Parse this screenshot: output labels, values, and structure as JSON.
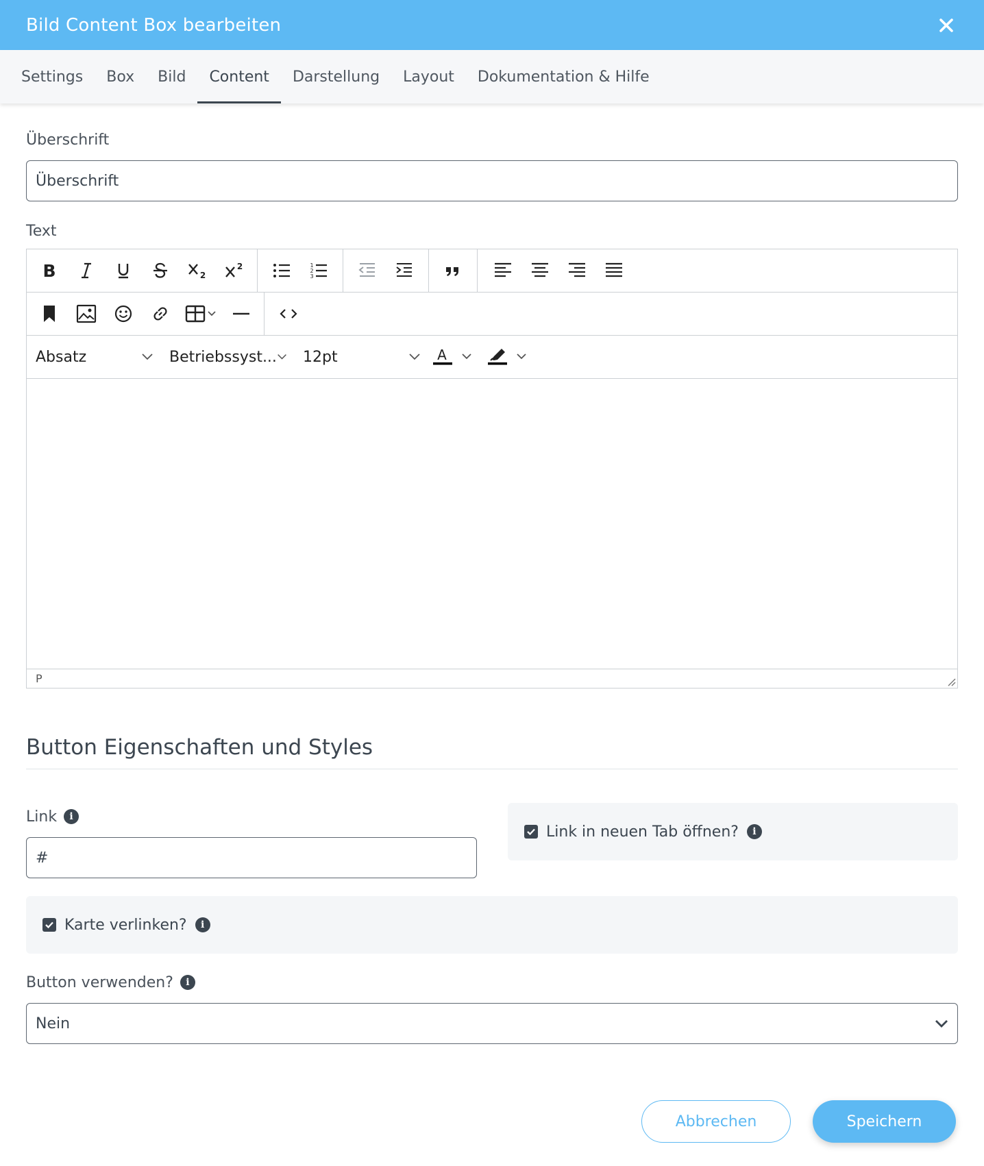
{
  "dialog": {
    "title": "Bild Content Box bearbeiten",
    "close_icon": "close-icon"
  },
  "tabs": [
    {
      "label": "Settings"
    },
    {
      "label": "Box"
    },
    {
      "label": "Bild"
    },
    {
      "label": "Content",
      "active": true
    },
    {
      "label": "Darstellung"
    },
    {
      "label": "Layout"
    },
    {
      "label": "Dokumentation & Hilfe"
    }
  ],
  "heading_field": {
    "label": "Überschrift",
    "value": "Überschrift"
  },
  "text_field": {
    "label": "Text",
    "toolbar": {
      "block_format": "Absatz",
      "font_family": "Betriebssyst...",
      "font_size": "12pt"
    },
    "statusbar_path": "P"
  },
  "button_section": {
    "title": "Button Eigenschaften und Styles",
    "link_label": "Link",
    "link_value": "#",
    "new_tab_label": "Link in neuen Tab öffnen?",
    "new_tab_checked": true,
    "link_card_label": "Karte verlinken?",
    "link_card_checked": true,
    "use_button_label": "Button verwenden?",
    "use_button_value": "Nein"
  },
  "footer": {
    "cancel_label": "Abbrechen",
    "save_label": "Speichern"
  },
  "colors": {
    "header": "#5db9f3",
    "primary_button": "#5db9f3",
    "text_dark": "#3c4650",
    "panel_bg": "#f4f6f8"
  }
}
